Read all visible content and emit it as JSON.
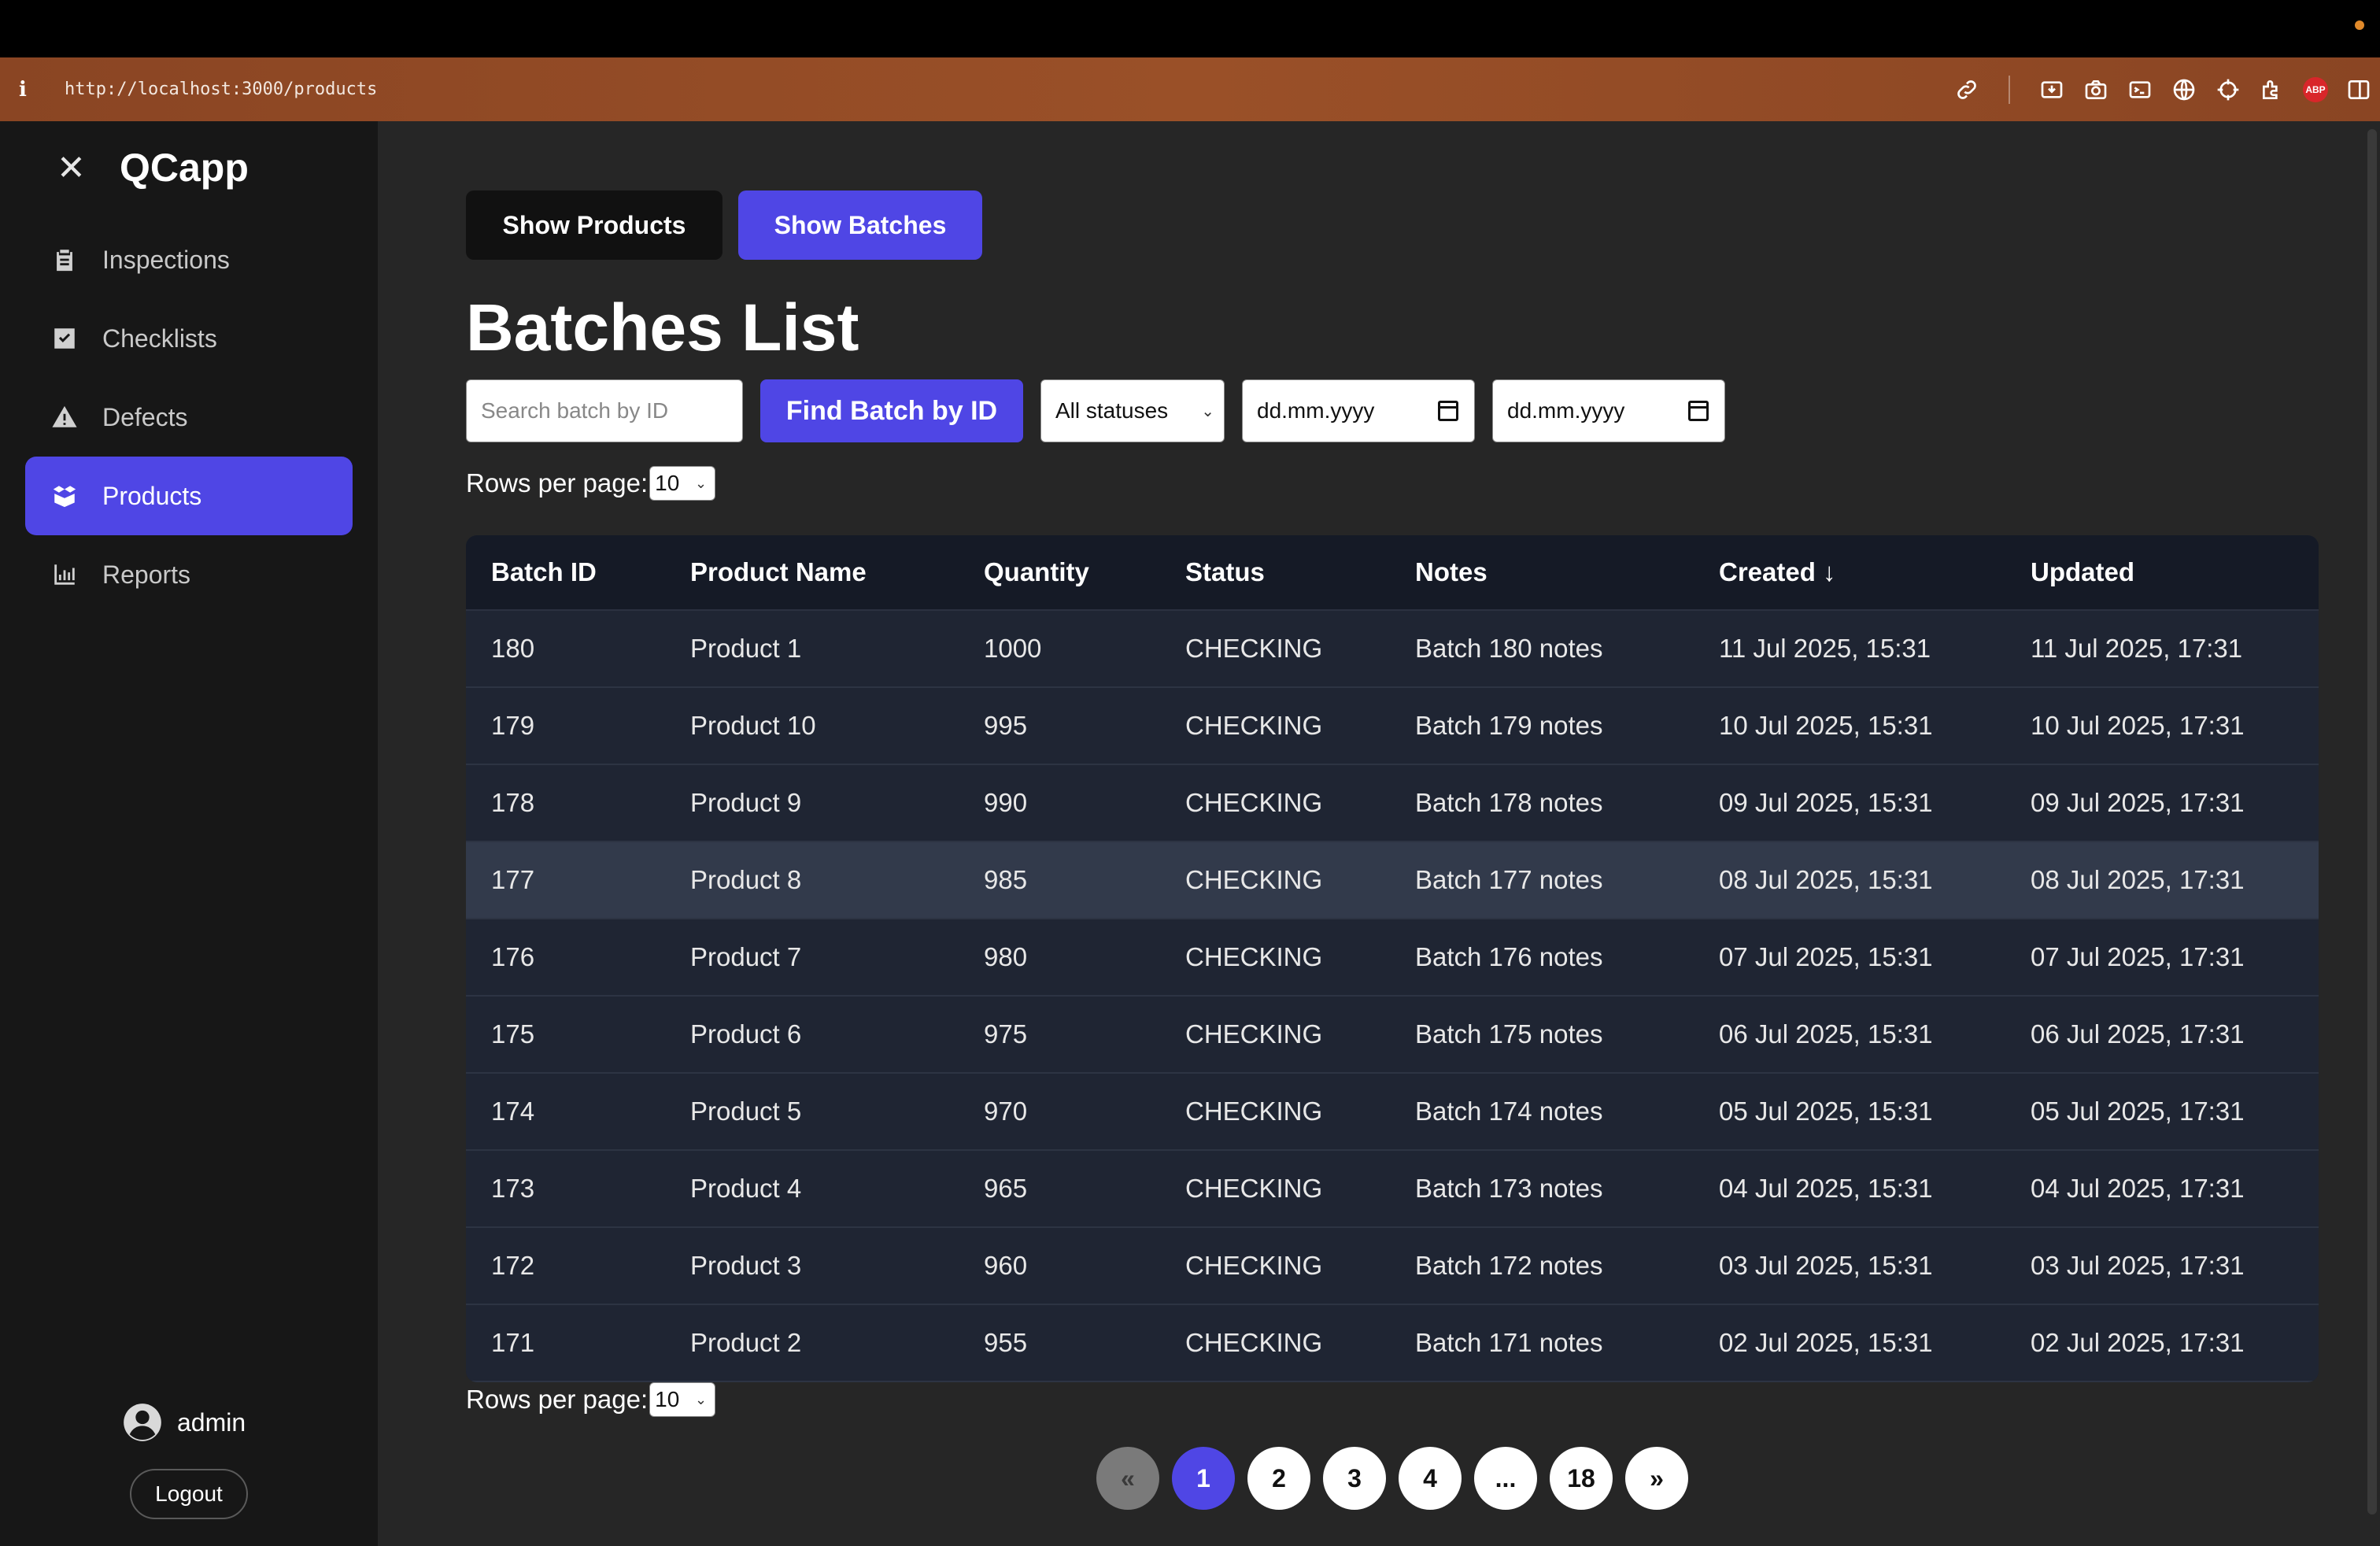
{
  "browser": {
    "url": "http://localhost:3000/products",
    "info_glyph": "i"
  },
  "sidebar": {
    "brand": "QCapp",
    "close_glyph": "✕",
    "items": [
      {
        "label": "Inspections",
        "icon": "clipboard-icon"
      },
      {
        "label": "Checklists",
        "icon": "checkbox-icon"
      },
      {
        "label": "Defects",
        "icon": "warning-icon"
      },
      {
        "label": "Products",
        "icon": "boxes-icon",
        "active": true
      },
      {
        "label": "Reports",
        "icon": "bar-chart-icon"
      }
    ],
    "user": "admin",
    "logout": "Logout"
  },
  "toolbar": {
    "show_products": "Show Products",
    "show_batches": "Show Batches"
  },
  "page_title": "Batches List",
  "filters": {
    "search_placeholder": "Search batch by ID",
    "find_button": "Find Batch by ID",
    "status": "All statuses",
    "date_from": "dd.mm.yyyy",
    "date_to": "dd.mm.yyyy"
  },
  "rows_per_page": {
    "label": "Rows per page:",
    "value": "10"
  },
  "table": {
    "columns": [
      "Batch ID",
      "Product Name",
      "Quantity",
      "Status",
      "Notes",
      "Created ↓",
      "Updated"
    ],
    "rows": [
      [
        "180",
        "Product 1",
        "1000",
        "CHECKING",
        "Batch 180 notes",
        "11 Jul 2025, 15:31",
        "11 Jul 2025, 17:31"
      ],
      [
        "179",
        "Product 10",
        "995",
        "CHECKING",
        "Batch 179 notes",
        "10 Jul 2025, 15:31",
        "10 Jul 2025, 17:31"
      ],
      [
        "178",
        "Product 9",
        "990",
        "CHECKING",
        "Batch 178 notes",
        "09 Jul 2025, 15:31",
        "09 Jul 2025, 17:31"
      ],
      [
        "177",
        "Product 8",
        "985",
        "CHECKING",
        "Batch 177 notes",
        "08 Jul 2025, 15:31",
        "08 Jul 2025, 17:31"
      ],
      [
        "176",
        "Product 7",
        "980",
        "CHECKING",
        "Batch 176 notes",
        "07 Jul 2025, 15:31",
        "07 Jul 2025, 17:31"
      ],
      [
        "175",
        "Product 6",
        "975",
        "CHECKING",
        "Batch 175 notes",
        "06 Jul 2025, 15:31",
        "06 Jul 2025, 17:31"
      ],
      [
        "174",
        "Product 5",
        "970",
        "CHECKING",
        "Batch 174 notes",
        "05 Jul 2025, 15:31",
        "05 Jul 2025, 17:31"
      ],
      [
        "173",
        "Product 4",
        "965",
        "CHECKING",
        "Batch 173 notes",
        "04 Jul 2025, 15:31",
        "04 Jul 2025, 17:31"
      ],
      [
        "172",
        "Product 3",
        "960",
        "CHECKING",
        "Batch 172 notes",
        "03 Jul 2025, 15:31",
        "03 Jul 2025, 17:31"
      ],
      [
        "171",
        "Product 2",
        "955",
        "CHECKING",
        "Batch 171 notes",
        "02 Jul 2025, 15:31",
        "02 Jul 2025, 17:31"
      ]
    ]
  },
  "pagination": {
    "prev": "«",
    "pages": [
      "1",
      "2",
      "3",
      "4",
      "...",
      "18"
    ],
    "next": "»",
    "current": "1"
  },
  "colors": {
    "accent": "#4f46e5",
    "sidebar_bg": "#171717",
    "main_bg": "#262626",
    "table_bg": "#1f2533"
  }
}
